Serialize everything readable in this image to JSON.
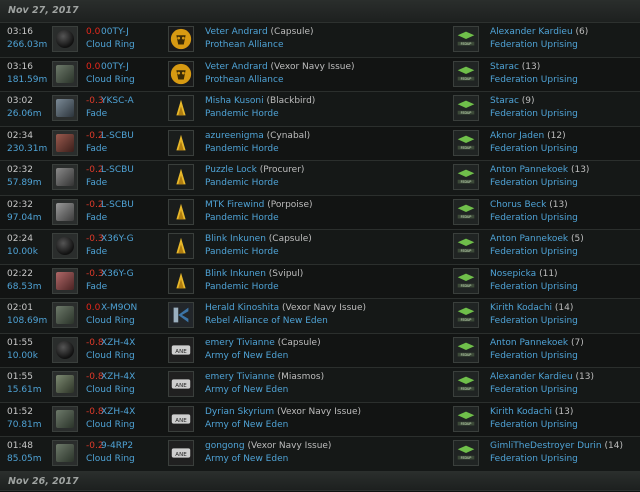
{
  "header": {
    "date": "Nov 27, 2017",
    "next_date": "Nov 26, 2017"
  },
  "kills": [
    {
      "time": "03:16",
      "isk": "266.03m",
      "ship_icon": "capsule-icon",
      "sec": "0.0",
      "system": "00TY-J",
      "region": "Cloud Ring",
      "victim": "Veter Andrard",
      "victim_ship": "(Capsule)",
      "victim_alliance": "Prothean Alliance",
      "victim_logo": "prothean-alliance-logo",
      "final_blow": "Alexander Kardieu",
      "involved": "(6)",
      "fb_alliance": "Federation Uprising",
      "fb_logo": "federation-uprising-logo"
    },
    {
      "time": "03:16",
      "isk": "181.59m",
      "ship_icon": "vexor-navy-issue-icon",
      "sec": "0.0",
      "system": "00TY-J",
      "region": "Cloud Ring",
      "victim": "Veter Andrard",
      "victim_ship": "(Vexor Navy Issue)",
      "victim_alliance": "Prothean Alliance",
      "victim_logo": "prothean-alliance-logo",
      "final_blow": "Starac",
      "involved": "(13)",
      "fb_alliance": "Federation Uprising",
      "fb_logo": "federation-uprising-logo"
    },
    {
      "time": "03:02",
      "isk": "26.06m",
      "ship_icon": "blackbird-icon",
      "sec": "-0.3",
      "system": "YKSC-A",
      "region": "Fade",
      "victim": "Misha Kusoni",
      "victim_ship": "(Blackbird)",
      "victim_alliance": "Pandemic Horde",
      "victim_logo": "pandemic-horde-logo",
      "final_blow": "Starac",
      "involved": "(9)",
      "fb_alliance": "Federation Uprising",
      "fb_logo": "federation-uprising-logo"
    },
    {
      "time": "02:34",
      "isk": "230.31m",
      "ship_icon": "cynabal-icon",
      "sec": "-0.2",
      "system": "L-SCBU",
      "region": "Fade",
      "victim": "azureenigma",
      "victim_ship": "(Cynabal)",
      "victim_alliance": "Pandemic Horde",
      "victim_logo": "pandemic-horde-logo",
      "final_blow": "Aknor Jaden",
      "involved": "(12)",
      "fb_alliance": "Federation Uprising",
      "fb_logo": "federation-uprising-logo"
    },
    {
      "time": "02:32",
      "isk": "57.89m",
      "ship_icon": "procurer-icon",
      "sec": "-0.2",
      "system": "L-SCBU",
      "region": "Fade",
      "victim": "Puzzle Lock",
      "victim_ship": "(Procurer)",
      "victim_alliance": "Pandemic Horde",
      "victim_logo": "pandemic-horde-logo",
      "final_blow": "Anton Pannekoek",
      "involved": "(13)",
      "fb_alliance": "Federation Uprising",
      "fb_logo": "federation-uprising-logo"
    },
    {
      "time": "02:32",
      "isk": "97.04m",
      "ship_icon": "porpoise-icon",
      "sec": "-0.2",
      "system": "L-SCBU",
      "region": "Fade",
      "victim": "MTK Firewind",
      "victim_ship": "(Porpoise)",
      "victim_alliance": "Pandemic Horde",
      "victim_logo": "pandemic-horde-logo",
      "final_blow": "Chorus Beck",
      "involved": "(13)",
      "fb_alliance": "Federation Uprising",
      "fb_logo": "federation-uprising-logo"
    },
    {
      "time": "02:24",
      "isk": "10.00k",
      "ship_icon": "capsule-icon",
      "sec": "-0.3",
      "system": "X36Y-G",
      "region": "Fade",
      "victim": "Blink Inkunen",
      "victim_ship": "(Capsule)",
      "victim_alliance": "Pandemic Horde",
      "victim_logo": "pandemic-horde-logo",
      "final_blow": "Anton Pannekoek",
      "involved": "(5)",
      "fb_alliance": "Federation Uprising",
      "fb_logo": "federation-uprising-logo"
    },
    {
      "time": "02:22",
      "isk": "68.53m",
      "ship_icon": "svipul-icon",
      "sec": "-0.3",
      "system": "X36Y-G",
      "region": "Fade",
      "victim": "Blink Inkunen",
      "victim_ship": "(Svipul)",
      "victim_alliance": "Pandemic Horde",
      "victim_logo": "pandemic-horde-logo",
      "final_blow": "Nosepicka",
      "involved": "(11)",
      "fb_alliance": "Federation Uprising",
      "fb_logo": "federation-uprising-logo"
    },
    {
      "time": "02:01",
      "isk": "108.69m",
      "ship_icon": "vexor-navy-issue-icon",
      "sec": "0.0",
      "system": "X-M9ON",
      "region": "Cloud Ring",
      "victim": "Herald Kinoshita",
      "victim_ship": "(Vexor Navy Issue)",
      "victim_alliance": "Rebel Alliance of New Eden",
      "victim_logo": "rebel-alliance-logo",
      "final_blow": "Kirith Kodachi",
      "involved": "(14)",
      "fb_alliance": "Federation Uprising",
      "fb_logo": "federation-uprising-logo"
    },
    {
      "time": "01:55",
      "isk": "10.00k",
      "ship_icon": "capsule-icon",
      "sec": "-0.8",
      "system": "XZH-4X",
      "region": "Cloud Ring",
      "victim": "emery Tivianne",
      "victim_ship": "(Capsule)",
      "victim_alliance": "Army of New Eden",
      "victim_logo": "army-of-new-eden-logo",
      "final_blow": "Anton Pannekoek",
      "involved": "(7)",
      "fb_alliance": "Federation Uprising",
      "fb_logo": "federation-uprising-logo"
    },
    {
      "time": "01:55",
      "isk": "15.61m",
      "ship_icon": "miasmos-icon",
      "sec": "-0.8",
      "system": "XZH-4X",
      "region": "Cloud Ring",
      "victim": "emery Tivianne",
      "victim_ship": "(Miasmos)",
      "victim_alliance": "Army of New Eden",
      "victim_logo": "army-of-new-eden-logo",
      "final_blow": "Alexander Kardieu",
      "involved": "(13)",
      "fb_alliance": "Federation Uprising",
      "fb_logo": "federation-uprising-logo"
    },
    {
      "time": "01:52",
      "isk": "70.81m",
      "ship_icon": "vexor-navy-issue-icon",
      "sec": "-0.8",
      "system": "XZH-4X",
      "region": "Cloud Ring",
      "victim": "Dyrian Skyrium",
      "victim_ship": "(Vexor Navy Issue)",
      "victim_alliance": "Army of New Eden",
      "victim_logo": "army-of-new-eden-logo",
      "final_blow": "Kirith Kodachi",
      "involved": "(13)",
      "fb_alliance": "Federation Uprising",
      "fb_logo": "federation-uprising-logo"
    },
    {
      "time": "01:48",
      "isk": "85.05m",
      "ship_icon": "vexor-navy-issue-icon",
      "sec": "-0.2",
      "system": "9-4RP2",
      "region": "Cloud Ring",
      "victim": "gongong",
      "victim_ship": "(Vexor Navy Issue)",
      "victim_alliance": "Army of New Eden",
      "victim_logo": "army-of-new-eden-logo",
      "final_blow": "GimliTheDestroyer Durin",
      "involved": "(14)",
      "fb_alliance": "Federation Uprising",
      "fb_logo": "federation-uprising-logo"
    }
  ]
}
